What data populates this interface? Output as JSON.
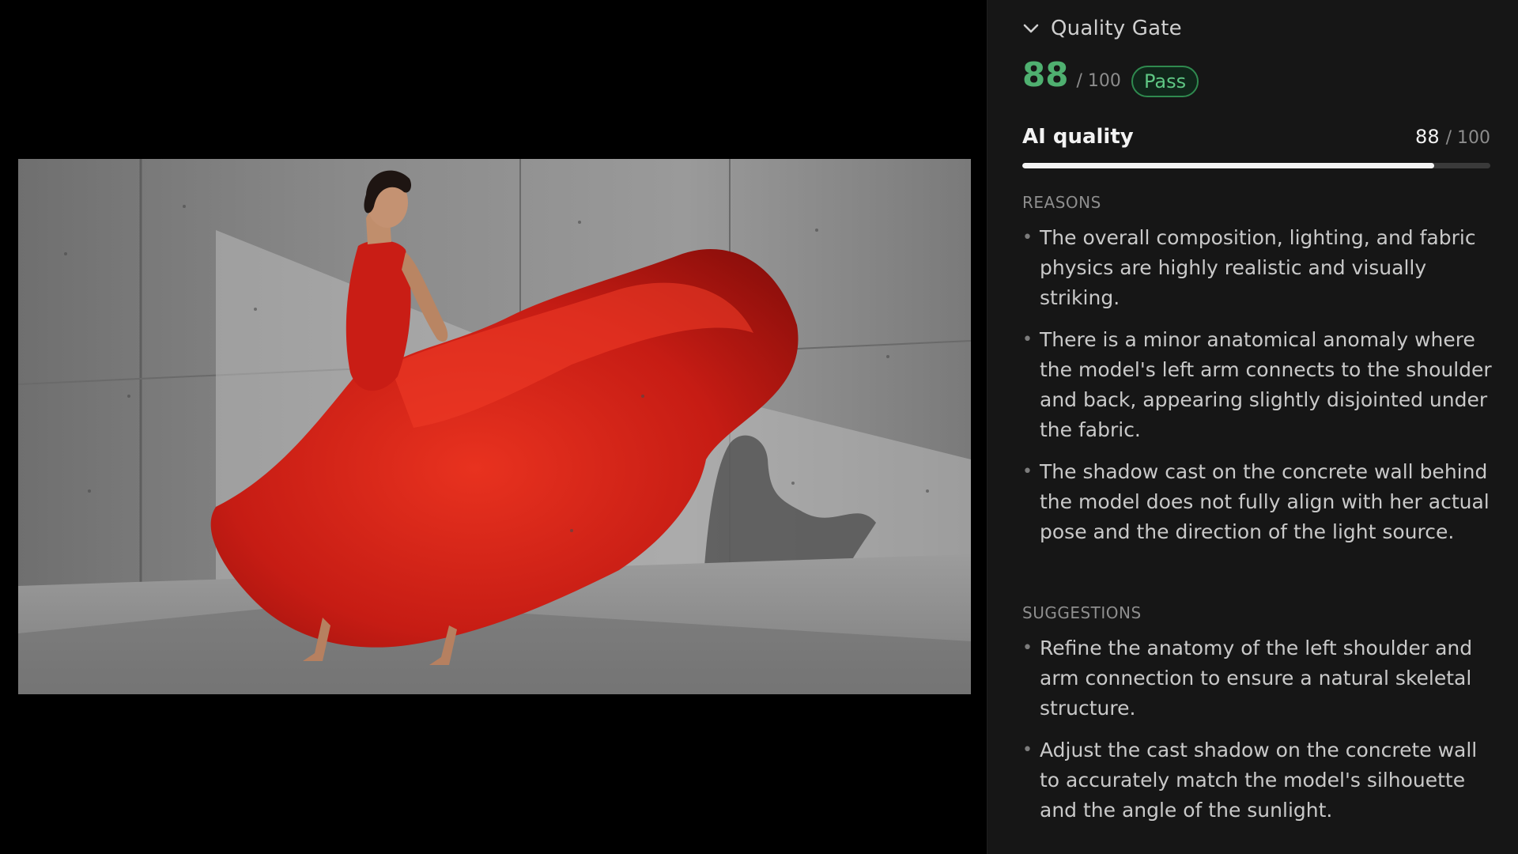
{
  "panel": {
    "section_title": "Quality Gate",
    "overall_score": "88",
    "overall_max": "/ 100",
    "status_badge": "Pass",
    "metric": {
      "label": "AI quality",
      "value": "88",
      "max": "/ 100",
      "progress_fraction": 0.88
    },
    "reasons_label": "REASONS",
    "reasons": [
      "The overall composition, lighting, and fabric physics are highly realistic and visually striking.",
      "There is a minor anatomical anomaly where the model's left arm connects to the shoulder and back, appearing slightly disjointed under the fabric.",
      "The shadow cast on the concrete wall behind the model does not fully align with her actual pose and the direction of the light source."
    ],
    "suggestions_label": "SUGGESTIONS",
    "suggestions": [
      "Refine the anatomy of the left shoulder and arm connection to ensure a natural skeletal structure.",
      "Adjust the cast shadow on the concrete wall to accurately match the model's silhouette and the angle of the sunlight."
    ]
  },
  "icons": {
    "collapse": "chevron-down-icon"
  },
  "colors": {
    "score_green": "#4fb070",
    "badge_green": "#5fc784",
    "panel_bg": "#161616",
    "dress_red": "#d0201a"
  }
}
